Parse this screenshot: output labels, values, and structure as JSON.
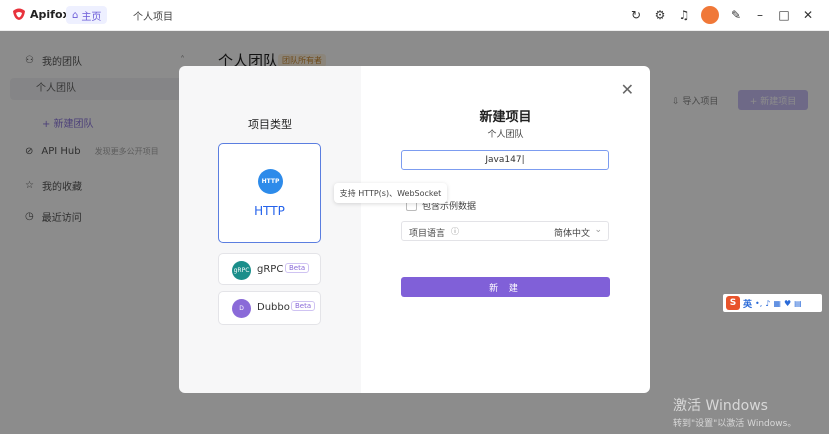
{
  "app": {
    "name": "Apifox",
    "logo_icon": "apifox-logo-icon"
  },
  "tabs": {
    "home": "主页",
    "project": "个人项目"
  },
  "titlebar_icons": [
    "refresh-icon",
    "settings-icon",
    "bell-icon",
    "avatar",
    "pin-icon",
    "minimize-icon",
    "maximize-icon",
    "close-icon"
  ],
  "sidebar": {
    "my_team": "我的团队",
    "personal_team": "个人团队",
    "new_team": "+ 新建团队",
    "api_hub": "API Hub",
    "api_hub_hint": "发现更多公开项目",
    "favorites": "我的收藏",
    "recent": "最近访问"
  },
  "main": {
    "title": "个人团队",
    "owner_badge": "团队所有者",
    "import_label": "导入项目",
    "new_team_button": "+ 新建项目"
  },
  "modal": {
    "type_title": "项目类型",
    "http_label": "HTTP",
    "http_icon_text": "HTTP",
    "grpc_label": "gRPC",
    "grpc_icon_text": "gRPC",
    "dubbo_label": "Dubbo",
    "dubbo_icon_text": "D",
    "beta": "Beta",
    "tooltip": "支持 HTTP(s)、WebSocket",
    "new_title": "新建项目",
    "team_sub": "个人团队",
    "project_name_value": "Java147",
    "sample_data_label": "包含示例数据",
    "lang_label": "项目语言",
    "lang_value": "简体中文",
    "create_button": "新 建"
  },
  "ime": {
    "label": "英",
    "logo": "S"
  },
  "watermark": {
    "line1": "激活 Windows",
    "line2": "转到\"设置\"以激活 Windows。"
  },
  "colors": {
    "accent": "#8060d8",
    "http_blue": "#2d8bea",
    "grpc_teal": "#1a8e8a",
    "dubbo_purple": "#8a6ad8"
  }
}
